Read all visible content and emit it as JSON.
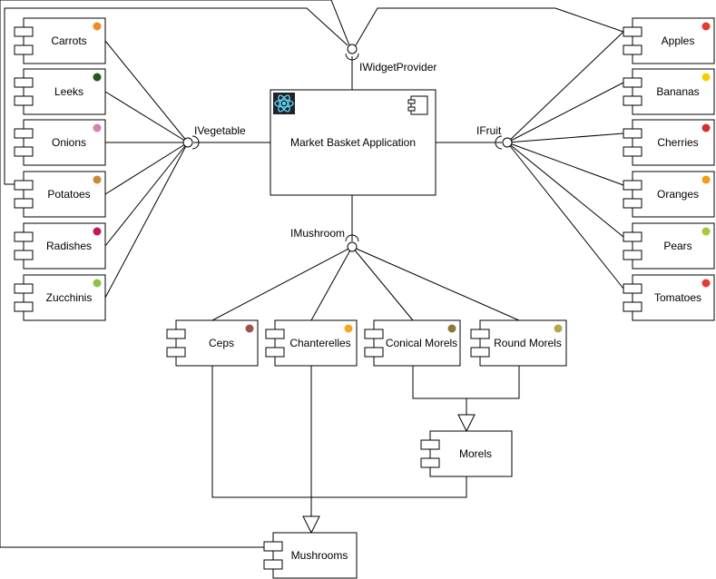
{
  "application": {
    "label": "Market Basket Application",
    "icon": "react-logo-icon"
  },
  "interfaces": {
    "vegetable": "IVegetable",
    "fruit": "IFruit",
    "widget_provider": "IWidgetProvider",
    "mushroom": "IMushroom"
  },
  "vegetables": [
    {
      "label": "Carrots",
      "icon": "carrot-icon",
      "color": "#f08a24"
    },
    {
      "label": "Leeks",
      "icon": "leek-icon",
      "color": "#1f5a1f"
    },
    {
      "label": "Onions",
      "icon": "onion-icon",
      "color": "#d77fb0"
    },
    {
      "label": "Potatoes",
      "icon": "potato-icon",
      "color": "#c98a3a"
    },
    {
      "label": "Radishes",
      "icon": "radish-icon",
      "color": "#c2185b"
    },
    {
      "label": "Zucchinis",
      "icon": "zucchini-icon",
      "color": "#8bc34a"
    }
  ],
  "fruits": [
    {
      "label": "Apples",
      "icon": "apple-icon",
      "color": "#e53935"
    },
    {
      "label": "Bananas",
      "icon": "banana-icon",
      "color": "#f5d000"
    },
    {
      "label": "Cherries",
      "icon": "cherries-icon",
      "color": "#d32f2f"
    },
    {
      "label": "Oranges",
      "icon": "orange-icon",
      "color": "#f39c12"
    },
    {
      "label": "Pears",
      "icon": "pear-icon",
      "color": "#a5c93a"
    },
    {
      "label": "Tomatoes",
      "icon": "tomato-icon",
      "color": "#e53935"
    }
  ],
  "mushrooms": [
    {
      "label": "Ceps",
      "icon": "cep-icon",
      "color": "#a0524d"
    },
    {
      "label": "Chanterelles",
      "icon": "chanterelle-icon",
      "color": "#f5a623"
    },
    {
      "label": "Conical Morels",
      "icon": "conical-morel-icon",
      "color": "#8a7a3a"
    },
    {
      "label": "Round Morels",
      "icon": "round-morel-icon",
      "color": "#b5a84a"
    }
  ],
  "morels": {
    "label": "Morels"
  },
  "mushrooms_parent": {
    "label": "Mushrooms"
  },
  "colors": {
    "react_bg": "#20232a",
    "react_fg": "#61dafb"
  }
}
